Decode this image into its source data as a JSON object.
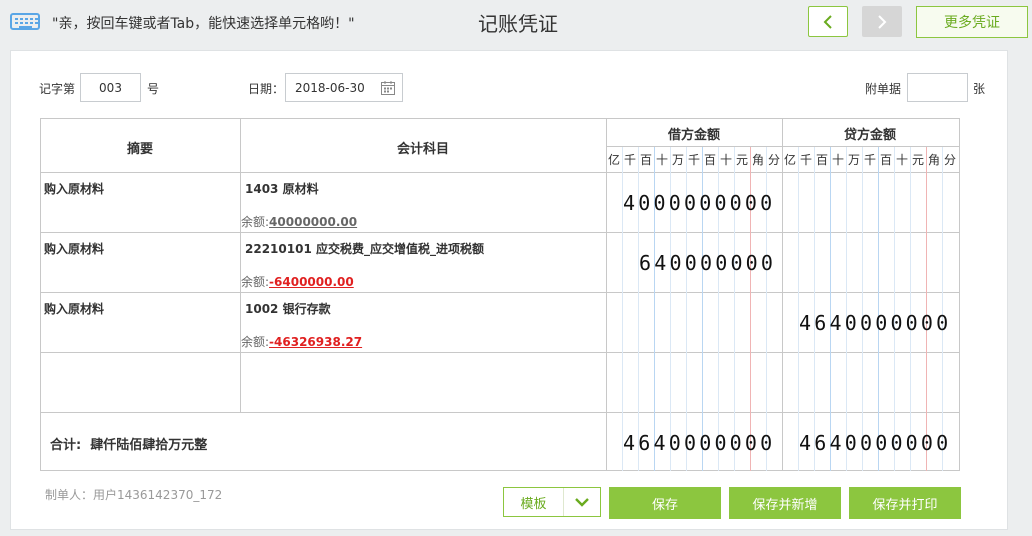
{
  "header": {
    "hint": "\"亲，按回车键或者Tab，能快速选择单元格哟！\"",
    "title": "记账凭证",
    "more_label": "更多凭证"
  },
  "voucher": {
    "word_label": "记字第",
    "number": "003",
    "number_suffix": "号",
    "date_label": "日期：",
    "date": "2018-06-30",
    "attach_label": "附单据",
    "attach_count": "",
    "attach_suffix": "张"
  },
  "table": {
    "col_summary": "摘要",
    "col_account": "会计科目",
    "col_debit": "借方金额",
    "col_credit": "贷方金额",
    "digit_units": [
      "亿",
      "千",
      "百",
      "十",
      "万",
      "千",
      "百",
      "十",
      "元",
      "角",
      "分"
    ],
    "rows": [
      {
        "summary": "购入原材料",
        "account": "1403 原材料",
        "balance_label": "余额:",
        "balance": "40000000.00",
        "balance_negative": false,
        "debit": "4000000000",
        "credit": ""
      },
      {
        "summary": "购入原材料",
        "account": "22210101 应交税费_应交增值税_进项税额",
        "balance_label": "余额:",
        "balance": "-6400000.00",
        "balance_negative": true,
        "debit": "640000000",
        "credit": ""
      },
      {
        "summary": "购入原材料",
        "account": "1002 银行存款",
        "balance_label": "余额:",
        "balance": "-46326938.27",
        "balance_negative": true,
        "debit": "",
        "credit": "4640000000"
      },
      {
        "summary": "",
        "account": "",
        "balance_label": "",
        "balance": "",
        "balance_negative": false,
        "debit": "",
        "credit": ""
      }
    ],
    "total_label": "合计:",
    "total_words": "肆仟陆佰肆拾万元整",
    "total_debit": "4640000000",
    "total_credit": "4640000000"
  },
  "footer": {
    "maker": "制单人：用户1436142370_172",
    "template_label": "模板",
    "save_label": "保存",
    "save_new_label": "保存并新增",
    "save_print_label": "保存并打印"
  },
  "colors": {
    "accent": "#8cc63f",
    "negative": "#e02020",
    "digit_line_blue": "#b9d6f2",
    "digit_line_red": "#f0b4b4"
  },
  "icons": [
    "keyboard-icon",
    "chevron-left-icon",
    "chevron-right-icon",
    "calendar-icon",
    "chevron-down-icon"
  ]
}
